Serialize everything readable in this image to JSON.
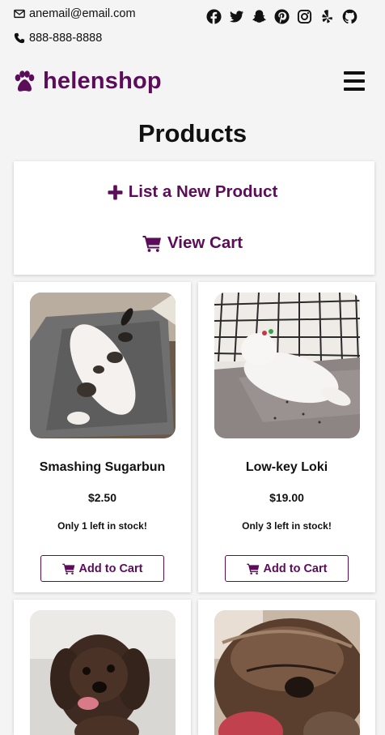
{
  "contact": {
    "email": "anemail@email.com",
    "phone": "888-888-8888",
    "email_icon": "envelope-icon",
    "phone_icon": "phone-icon"
  },
  "socials": [
    "facebook-icon",
    "twitter-icon",
    "snapchat-icon",
    "pinterest-icon",
    "instagram-icon",
    "yelp-icon",
    "github-icon"
  ],
  "brand": {
    "name": "helenshop",
    "icon": "paw-icon",
    "color": "#5b0d5a"
  },
  "nav": {
    "menu_icon": "hamburger-menu-icon"
  },
  "page": {
    "title": "Products"
  },
  "actions": {
    "list_label": "List a New Product",
    "list_icon": "plus-icon",
    "cart_label": "View Cart",
    "cart_icon": "shopping-cart-icon"
  },
  "products": [
    {
      "name": "Smashing Sugarbun",
      "price": "$2.50",
      "stock": "Only 1 left in stock!",
      "button": "Add to Cart"
    },
    {
      "name": "Low-key Loki",
      "price": "$19.00",
      "stock": "Only 3 left in stock!",
      "button": "Add to Cart"
    },
    {
      "name": "",
      "price": "",
      "stock": "",
      "button": ""
    },
    {
      "name": "",
      "price": "",
      "stock": "",
      "button": ""
    }
  ]
}
